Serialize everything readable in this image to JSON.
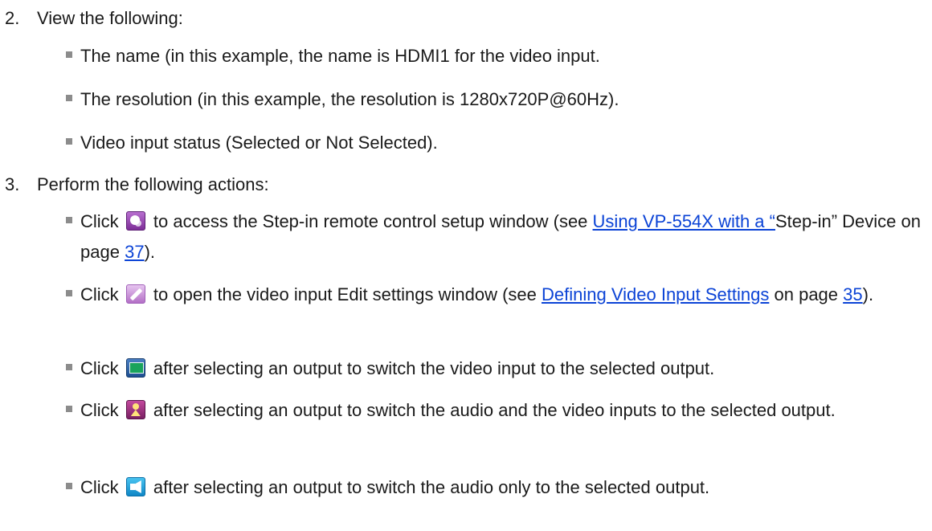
{
  "steps": [
    {
      "number": "2.",
      "text": "View the following:",
      "items": [
        "The name (in this example, the name is HDMI1 for the video input.",
        "The resolution (in this example, the resolution is 1280x720P@60Hz).",
        "Video input status (Selected or Not Selected)."
      ]
    },
    {
      "number": "3.",
      "text": "Perform the following actions:",
      "items": [
        {
          "click": "Click",
          "icon": "step-in-remote-icon",
          "before": "to access the Step-in remote control setup window (see",
          "link1": "Using VP-554X with a “",
          "middle": "Step-in” Device on page",
          "page_link": "37",
          "after": ")."
        },
        {
          "click": "Click",
          "icon": "edit-pencil-icon",
          "before": "to open the video input Edit settings window (see",
          "link1": "Defining Video Input Settings",
          "middle": "on page",
          "page_link": "35",
          "after": ")."
        },
        {
          "click": "Click",
          "icon": "video-switch-icon",
          "text": "after selecting an output to switch the video input to the selected output."
        },
        {
          "click": "Click",
          "icon": "audio-video-switch-icon",
          "text": "after selecting an output to switch the audio and the video inputs to the selected output."
        },
        {
          "click": "Click",
          "icon": "audio-switch-icon",
          "text": "after selecting an output to switch the audio only to the selected output."
        }
      ]
    }
  ]
}
